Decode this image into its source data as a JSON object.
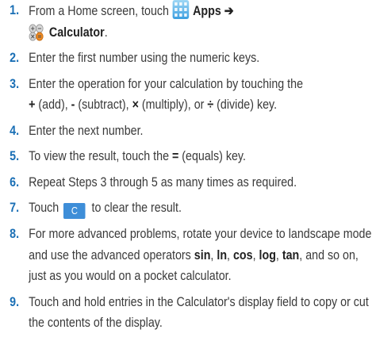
{
  "colors": {
    "step_number": "#1a6fb5",
    "c_key_bg": "#3e8ed8",
    "text": "#3a3a3a"
  },
  "icons": {
    "apps": "apps-grid-icon",
    "calculator": "calculator-icon"
  },
  "steps": [
    {
      "num": "1.",
      "a": "From a Home screen, touch",
      "apps": "Apps",
      "arrow": "➔",
      "calc": "Calculator",
      "end": "."
    },
    {
      "num": "2.",
      "text": "Enter the first number using the numeric keys."
    },
    {
      "num": "3.",
      "a": "Enter the operation for your calculation by touching the",
      "add_sym": "+",
      "add_txt": " (add), ",
      "sub_sym": "-",
      "sub_txt": " (subtract), ",
      "mul_sym": "×",
      "mul_txt": " (multiply), or ",
      "div_sym": "÷",
      "div_txt": " (divide) key."
    },
    {
      "num": "4.",
      "text": "Enter the next number."
    },
    {
      "num": "5.",
      "a": "To view the result, touch the ",
      "eq": "=",
      "b": " (equals) key."
    },
    {
      "num": "6.",
      "text": "Repeat Steps 3 through 5 as many times as required."
    },
    {
      "num": "7.",
      "a": "Touch",
      "key": "C",
      "b": "to clear the result."
    },
    {
      "num": "8.",
      "a": "For more advanced problems, rotate your device to landscape mode and use the advanced operators ",
      "sin": "sin",
      "c1": ", ",
      "ln": "ln",
      "c2": ", ",
      "cos": "cos",
      "c3": ", ",
      "log": "log",
      "c4": ", ",
      "tan": "tan",
      "b": ", and so on, just as you would on a pocket calculator."
    },
    {
      "num": "9.",
      "text": "Touch and hold entries in the Calculator's display field to copy or cut the contents of the display."
    }
  ]
}
